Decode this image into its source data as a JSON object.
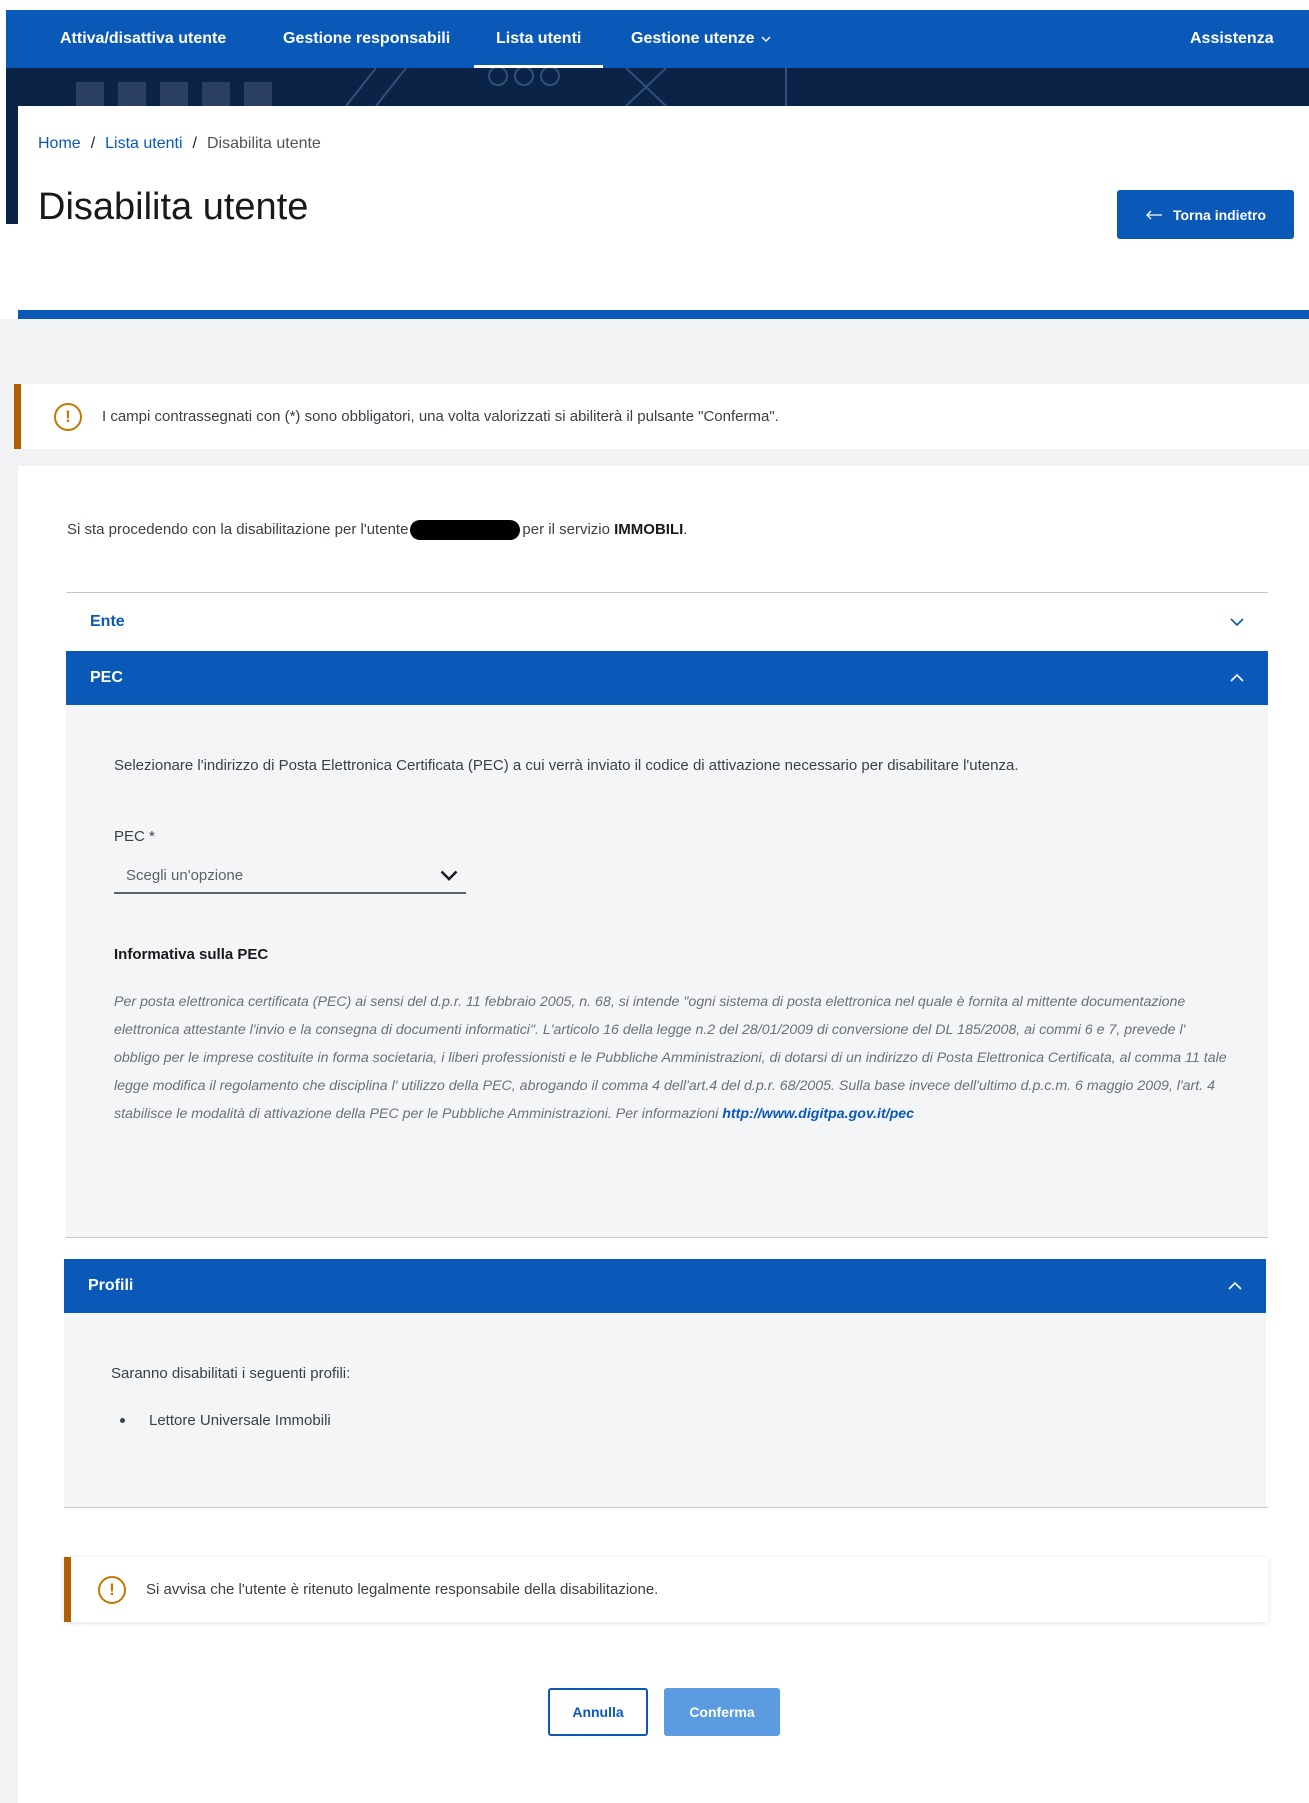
{
  "nav": {
    "items": [
      {
        "label": "Attiva/disattiva utente"
      },
      {
        "label": "Gestione responsabili"
      },
      {
        "label": "Lista utenti"
      },
      {
        "label": "Gestione utenze"
      }
    ],
    "active_item": "Lista utenti",
    "assistance": "Assistenza"
  },
  "breadcrumb": {
    "home": "Home",
    "separator": "/",
    "list": "Lista utenti",
    "current": "Disabilita utente"
  },
  "page": {
    "title": "Disabilita utente",
    "back_button": "Torna indietro"
  },
  "alert_required": {
    "icon": "warning-circle-icon",
    "text": "I campi contrassegnati con (*) sono obbligatori, una volta valorizzati si abiliterà il pulsante \"Conferma\"."
  },
  "intro": {
    "prefix": "Si sta procedendo con la disabilitazione per l'utente",
    "middle": "per il servizio",
    "service": "IMMOBILI",
    "suffix": "."
  },
  "accordion": {
    "ente": {
      "label": "Ente",
      "expanded": false
    },
    "pec": {
      "label": "PEC",
      "expanded": true,
      "description": "Selezionare l'indirizzo di Posta Elettronica Certificata (PEC) a cui verrà inviato il codice di attivazione necessario per disabilitare l'utenza.",
      "field_label": "PEC *",
      "select_placeholder": "Scegli un'opzione",
      "info_title": "Informativa sulla PEC",
      "info_text": "Per posta elettronica certificata (PEC) ai sensi del d.p.r. 11 febbraio 2005, n. 68, si intende \"ogni sistema di posta elettronica nel quale è fornita al mittente documentazione elettronica attestante l'invio e la consegna di documenti informatici\". L'articolo 16 della legge n.2 del 28/01/2009 di conversione del DL 185/2008, ai commi 6 e 7, prevede l' obbligo per le imprese costituite in forma societaria, i liberi professionisti e le Pubbliche Amministrazioni, di dotarsi di un indirizzo di Posta Elettronica Certificata, al comma 11 tale legge modifica il regolamento che disciplina l' utilizzo della PEC, abrogando il comma 4 dell'art.4 del d.p.r. 68/2005. Sulla base invece dell'ultimo d.p.c.m. 6 maggio 2009, l'art. 4 stabilisce le modalità di attivazione della PEC per le Pubbliche Amministrazioni. Per informazioni",
      "info_link": "http://www.digitpa.gov.it/pec"
    },
    "profili": {
      "label": "Profili",
      "expanded": true,
      "description": "Saranno disabilitati i seguenti profili:",
      "items": [
        "Lettore Universale Immobili"
      ]
    }
  },
  "alert_responsibility": {
    "icon": "warning-circle-icon",
    "text": "Si avvisa che l'utente è ritenuto legalmente responsabile della disabilitazione."
  },
  "actions": {
    "cancel": "Annulla",
    "confirm": "Conferma"
  },
  "colors": {
    "primary": "#0a59b8",
    "hero_dark": "#0b2346",
    "warning_border": "#b05f00",
    "confirm_disabled": "#5b9be0",
    "page_bg": "#f1f2f3"
  }
}
